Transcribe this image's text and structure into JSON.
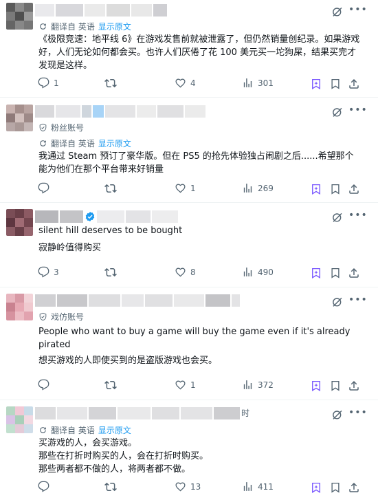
{
  "colors": {
    "secondary": "#536471",
    "link": "#1d9bf0",
    "grok_purple": "#7856ff",
    "border": "#eff3f4"
  },
  "posts": [
    {
      "meta": {
        "translate_label": "翻译自 英语",
        "show_original": "显示原文"
      },
      "text": "《极限竞速：地平线 6》在游戏发售前就被泄露了，但仍然销量创纪录。如果游戏好，人们无论如何都会买。也许人们厌倦了花 100 美元买一坨狗屎，结果买完才发现是这样。",
      "stats": {
        "replies": "1",
        "reposts": "",
        "likes": "4",
        "views": "301"
      }
    },
    {
      "badge": "粉丝账号",
      "meta": {
        "translate_label": "翻译自 英语",
        "show_original": "显示原文"
      },
      "text": "我通过 Steam 预订了豪华版。但在 PS5 的抢先体验独占闹剧之后......希望那个能为他们在那个平台带来好销量",
      "stats": {
        "replies": "",
        "reposts": "",
        "likes": "1",
        "views": "269"
      }
    },
    {
      "original_text": "silent hill deserves to be bought",
      "text": "寂静岭值得购买",
      "stats": {
        "replies": "3",
        "reposts": "",
        "likes": "8",
        "views": "490"
      }
    },
    {
      "badge": "戏仿账号",
      "original_text": "People who want to buy a game will buy the game even if it's already pirated",
      "text": "想买游戏的人即使买到的是盗版游戏也会买。",
      "stats": {
        "replies": "",
        "reposts": "",
        "likes": "1",
        "views": "372"
      }
    },
    {
      "name_suffix": "时",
      "meta": {
        "translate_label": "翻译自 英语",
        "show_original": "显示原文"
      },
      "text": "买游戏的人，会买游戏。\n那些在打折时购买的人，会在打折时购买。\n那些两者都不做的人，将两者都不做。",
      "stats": {
        "replies": "",
        "reposts": "",
        "likes": "13",
        "views": "411"
      }
    }
  ]
}
